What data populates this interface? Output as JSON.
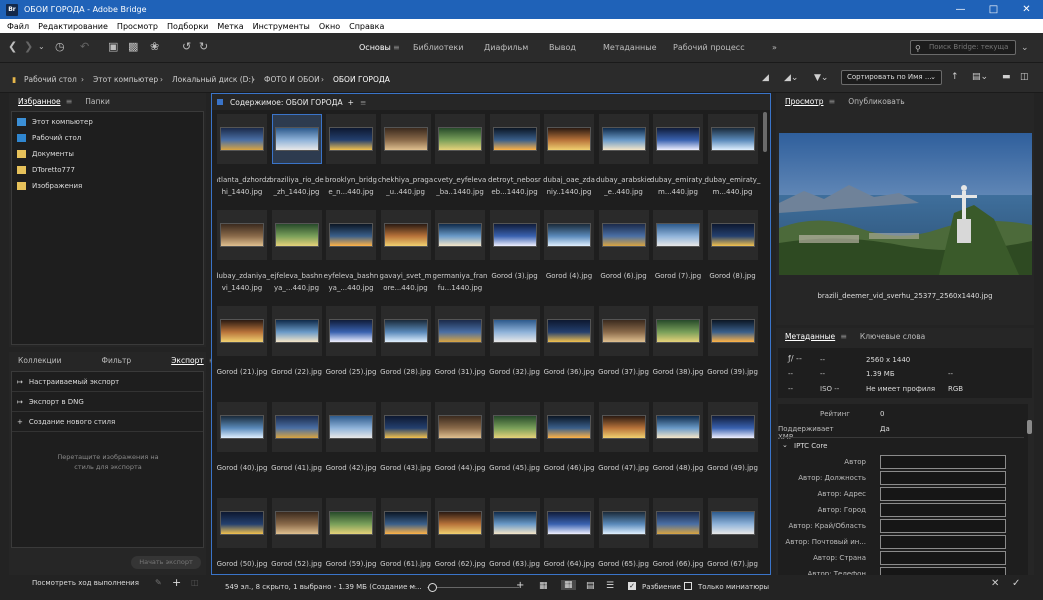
{
  "window": {
    "title": "ОБОИ ГОРОДА - Adobe Bridge",
    "app_badge": "Br"
  },
  "menu": [
    "Файл",
    "Редактирование",
    "Просмотр",
    "Подборки",
    "Метка",
    "Инструменты",
    "Окно",
    "Справка"
  ],
  "workspaces": [
    {
      "label": "Основы",
      "active": true
    },
    {
      "label": "Библиотеки",
      "active": false
    },
    {
      "label": "Диафильм",
      "active": false
    },
    {
      "label": "Вывод",
      "active": false
    },
    {
      "label": "Метаданные",
      "active": false
    },
    {
      "label": "Рабочий процесс",
      "active": false
    }
  ],
  "search": {
    "placeholder": "Поиск Bridge: текуща"
  },
  "breadcrumb": [
    "Рабочий стол",
    "Этот компьютер",
    "Локальный диск (D:)",
    "ФОТО И ОБОИ",
    "ОБОИ ГОРОДА"
  ],
  "sort": {
    "label": "Сортировать по Имя ..."
  },
  "favorites": {
    "tabs": [
      "Избранное",
      "Папки"
    ],
    "items": [
      "Этот компьютер",
      "Рабочий стол",
      "Документы",
      "DToretto777",
      "Изображения"
    ]
  },
  "export": {
    "tabs": [
      "Коллекции",
      "Фильтр",
      "Экспорт"
    ],
    "items": [
      "Настраиваемый экспорт",
      "Экспорт в DNG",
      "Создание нового стиля"
    ],
    "hint": "Перетащите изображения на стиль для экспорта",
    "start_button": "Начать экспорт",
    "progress_label": "Посмотреть ход выполнения"
  },
  "content": {
    "title": "Содержимое: ОБОИ ГОРОДА",
    "rows": [
      [
        "atlanta_dzhordzhi_1440.jpg",
        "braziliya_rio_de_zh_1440.jpg",
        "brooklyn_bridge_n...440.jpg",
        "chekhiya_praga_u..440.jpg",
        "cvety_eyfeleva_ba..1440.jpg",
        "detroyt_nebosreb...1440.jpg",
        "dubaj_oae_zdaniy..1440.jpg",
        "dubay_arabskie_e..440.jpg",
        "dubay_emiraty_m...440.jpg",
        "dubay_emiraty_m...440.jpg"
      ],
      [
        "dubay_zdaniya_vi_1440.jpg",
        "ejfeleva_bashnya_...440.jpg",
        "eyfeleva_bashnya_...440.jpg",
        "gavayi_svet_more...440.jpg",
        "germaniya_franfu...1440.jpg",
        "Gorod (3).jpg",
        "Gorod (4).jpg",
        "Gorod (6).jpg",
        "Gorod (7).jpg",
        "Gorod (8).jpg"
      ],
      [
        "Gorod (21).jpg",
        "Gorod (22).jpg",
        "Gorod (25).jpg",
        "Gorod (28).jpg",
        "Gorod (31).jpg",
        "Gorod (32).jpg",
        "Gorod (36).jpg",
        "Gorod (37).jpg",
        "Gorod (38).jpg",
        "Gorod (39).jpg"
      ],
      [
        "Gorod (40).jpg",
        "Gorod (41).jpg",
        "Gorod (42).jpg",
        "Gorod (43).jpg",
        "Gorod (44).jpg",
        "Gorod (45).jpg",
        "Gorod (46).jpg",
        "Gorod (47).jpg",
        "Gorod (48).jpg",
        "Gorod (49).jpg"
      ],
      [
        "Gorod (50).jpg",
        "Gorod (52).jpg",
        "Gorod (59).jpg",
        "Gorod (61).jpg",
        "Gorod (62).jpg",
        "Gorod (63).jpg",
        "Gorod (64).jpg",
        "Gorod (65).jpg",
        "Gorod (66).jpg",
        "Gorod (67).jpg"
      ]
    ],
    "selected_index": 1
  },
  "status": {
    "text": "549 эл., 8 скрыто, 1 выбрано - 1.39 МБ (Создание м...",
    "razbienie": "Разбиение",
    "only_thumbs": "Только миниатюры",
    "zoom_fraction": 0.05
  },
  "preview": {
    "tabs": [
      "Просмотр",
      "Опубликовать"
    ],
    "filename": "brazili_deemer_vid_sverhu_25377_2560x1440.jpg"
  },
  "metadata": {
    "tabs": [
      "Метаданные",
      "Ключевые слова"
    ],
    "placard": {
      "f": "ƒ/ --",
      "d1": "--",
      "d2": "--",
      "d3": "--",
      "d4": "--",
      "iso": "ISO --",
      "dims": "2560 x 1440",
      "size": "1.39 МБ",
      "profile": "Не имеет профиля",
      "dash": "--",
      "mode": "RGB"
    },
    "rating_label": "Рейтинг",
    "rating_value": "0",
    "xmp_label": "Поддерживает XMP",
    "xmp_value": "Да",
    "iptc": "IPTC Core",
    "fields": [
      "Автор",
      "Автор: Должность",
      "Автор: Адрес",
      "Автор: Город",
      "Автор: Край/Область",
      "Автор: Почтовый ин...",
      "Автор: Страна",
      "Автор: Телефон"
    ]
  },
  "colors": {
    "accent": "#3a74c9",
    "titlebar": "#1f62b8"
  }
}
